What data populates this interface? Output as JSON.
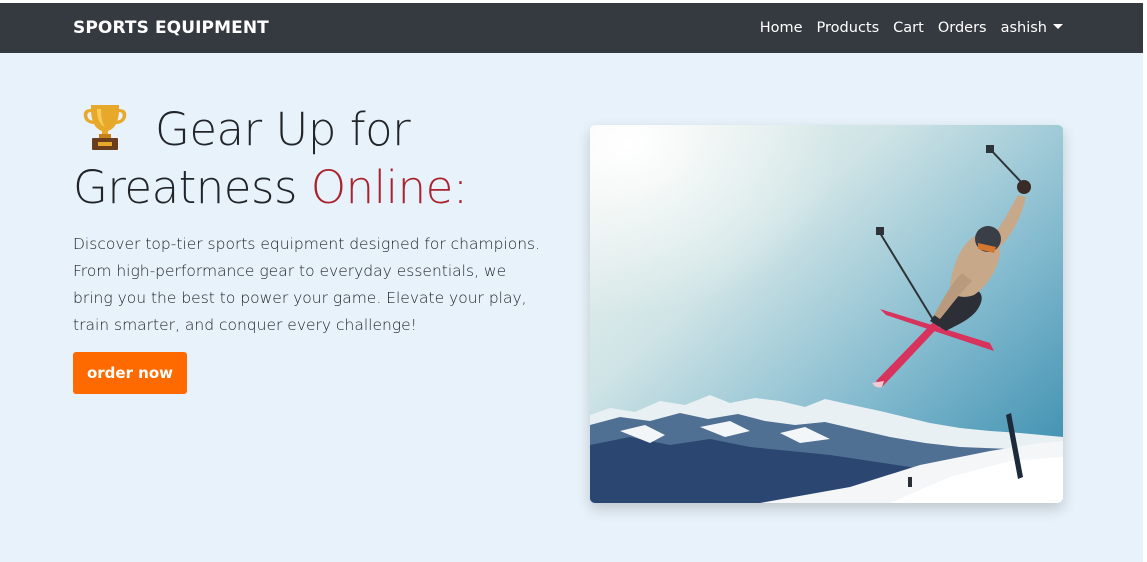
{
  "navbar": {
    "brand": "SPORTS EQUIPMENT",
    "links": [
      "Home",
      "Products",
      "Cart",
      "Orders"
    ],
    "user": "ashish",
    "background": "#343a40"
  },
  "hero": {
    "trophy_icon": "trophy-icon",
    "title_main": "Gear Up for Greatness ",
    "title_accent": "Online:",
    "accent_color": "#a8232e",
    "description": "Discover top-tier sports equipment designed for champions. From high-performance gear to everyday essentials, we bring you the best to power your game. Elevate your play, train smarter, and conquer every challenge!",
    "button_label": "order now",
    "button_color": "#ff6a00",
    "background": "#e8f2fa",
    "image_subject": "skier-jump-photo"
  }
}
